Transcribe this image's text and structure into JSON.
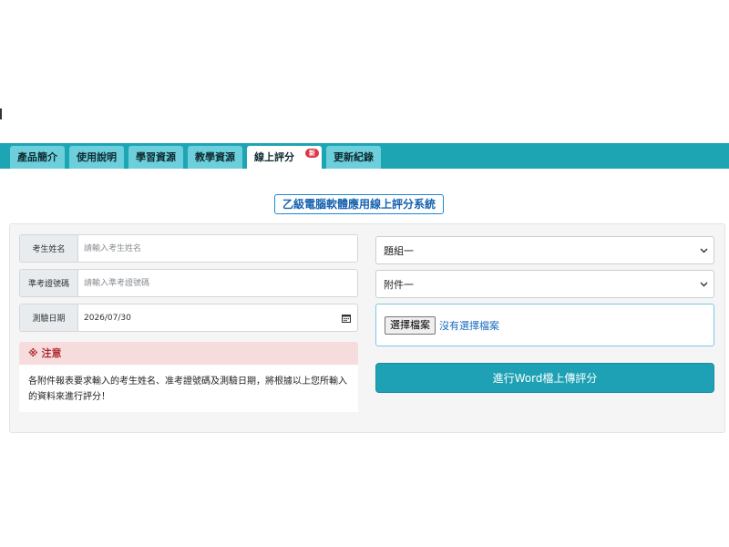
{
  "tabs": [
    {
      "label": "產品簡介"
    },
    {
      "label": "使用說明"
    },
    {
      "label": "學習資源"
    },
    {
      "label": "教學資源"
    },
    {
      "label": "線上評分",
      "badge": "新",
      "active": true
    },
    {
      "label": "更新紀錄"
    }
  ],
  "title": "乙級電腦軟體應用線上評分系統",
  "form": {
    "name": {
      "label": "考生姓名",
      "placeholder": "請輸入考生姓名",
      "value": ""
    },
    "id": {
      "label": "準考證號碼",
      "placeholder": "請輸入準考證號碼",
      "value": ""
    },
    "date": {
      "label": "測驗日期",
      "value": "2026/07/30"
    }
  },
  "notice": {
    "heading": "※ 注意",
    "body": "各附件報表要求輸入的考生姓名、准考證號碼及測驗日期，將根據以上您所輸入的資料來進行評分！"
  },
  "selects": {
    "group": {
      "selected": "題組一"
    },
    "attachment": {
      "selected": "附件一"
    }
  },
  "file": {
    "button_label": "選擇檔案",
    "status": "沒有選擇檔案"
  },
  "submit_label": "進行Word檔上傳評分",
  "colors": {
    "tabbar": "#1ea5b4",
    "tab": "#6ccfdb",
    "submit": "#1ea1b5",
    "title": "#1762b0",
    "notice_bg": "#f6dcdd"
  }
}
